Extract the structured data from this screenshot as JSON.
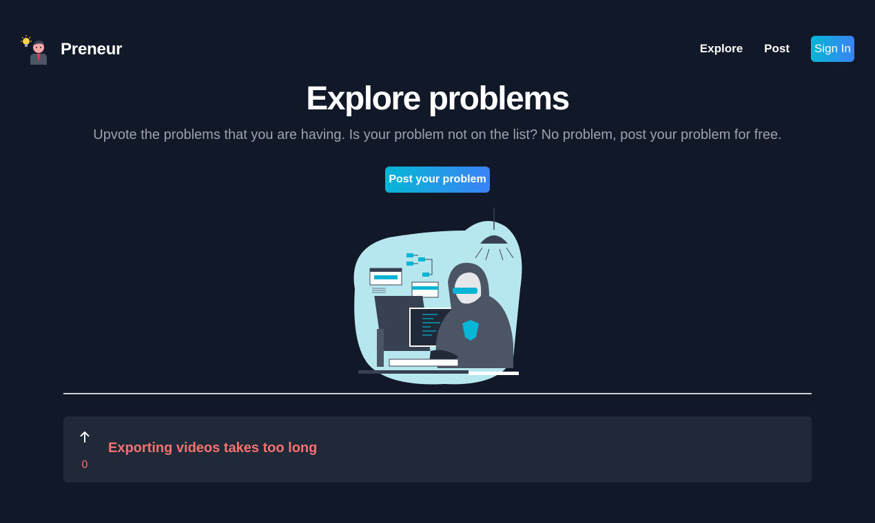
{
  "nav": {
    "brand": "Preneur",
    "links": [
      "Explore",
      "Post"
    ],
    "signin_label": "Sign In"
  },
  "hero": {
    "title": "Explore problems",
    "subtitle": "Upvote the problems that you are having. Is your problem not on the list? No problem, post your problem for free.",
    "cta_label": "Post your problem",
    "illustration_icon": "hooded-programmer-illustration"
  },
  "problems": [
    {
      "title": "Exporting videos takes too long",
      "votes": "0",
      "vote_icon": "arrow-up-icon"
    }
  ],
  "colors": {
    "background": "#111827",
    "card": "#1f2937",
    "accent_gradient_start": "#06b6d4",
    "accent_gradient_end": "#3b82f6",
    "problem_title": "#f87171",
    "subtitle": "#9ca3af"
  }
}
